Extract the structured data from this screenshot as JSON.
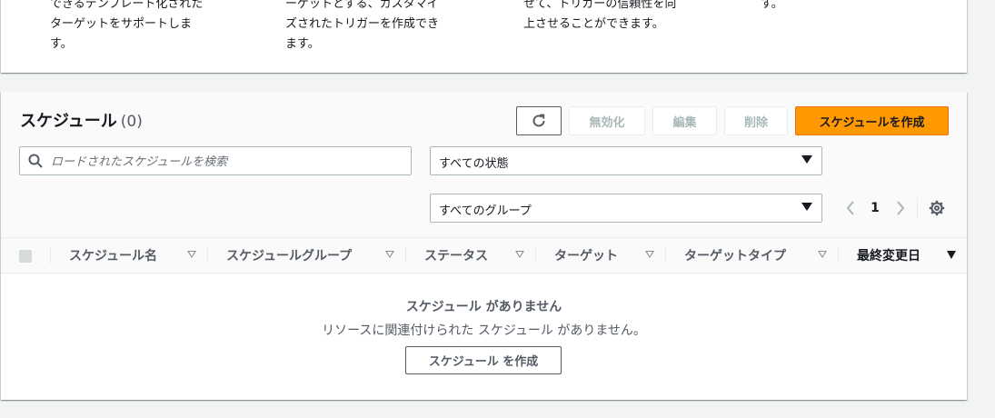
{
  "features": [
    {
      "line1": "できるテンプレート化された",
      "line2": "ターゲットをサポートしま",
      "line3": "す。"
    },
    {
      "line1": "ーゲットとする、カスタマイ",
      "line2": "ズされたトリガーを作成でき",
      "line3": "ます。"
    },
    {
      "line1": "せて、トリガーの信頼性を向",
      "line2": "上させることができます。",
      "line3": ""
    },
    {
      "line1": "す。",
      "line2": "",
      "line3": ""
    }
  ],
  "schedules": {
    "title": "スケジュール",
    "count": "(0)",
    "toolbar": {
      "disable_label": "無効化",
      "edit_label": "編集",
      "delete_label": "削除",
      "create_label": "スケジュールを作成"
    },
    "search": {
      "placeholder": "ロードされたスケジュールを検索"
    },
    "filters": {
      "status": "すべての状態",
      "group": "すべてのグループ"
    },
    "pagination": {
      "current_page": "1"
    },
    "columns": [
      "スケジュール名",
      "スケジュールグループ",
      "ステータス",
      "ターゲット",
      "ターゲットタイプ",
      "最終変更日"
    ],
    "empty": {
      "title": "スケジュール がありません",
      "description": "リソースに関連付けられた スケジュール がありません。",
      "button_label": "スケジュール を作成"
    }
  },
  "colors": {
    "primary": "#ff9900",
    "border": "#aab7b8",
    "text_secondary": "#545b64"
  },
  "icons": [
    "refresh-icon",
    "search-icon",
    "chevron-left-icon",
    "chevron-right-icon",
    "settings-gear-icon",
    "caret-down-icon",
    "sort-icon"
  ]
}
